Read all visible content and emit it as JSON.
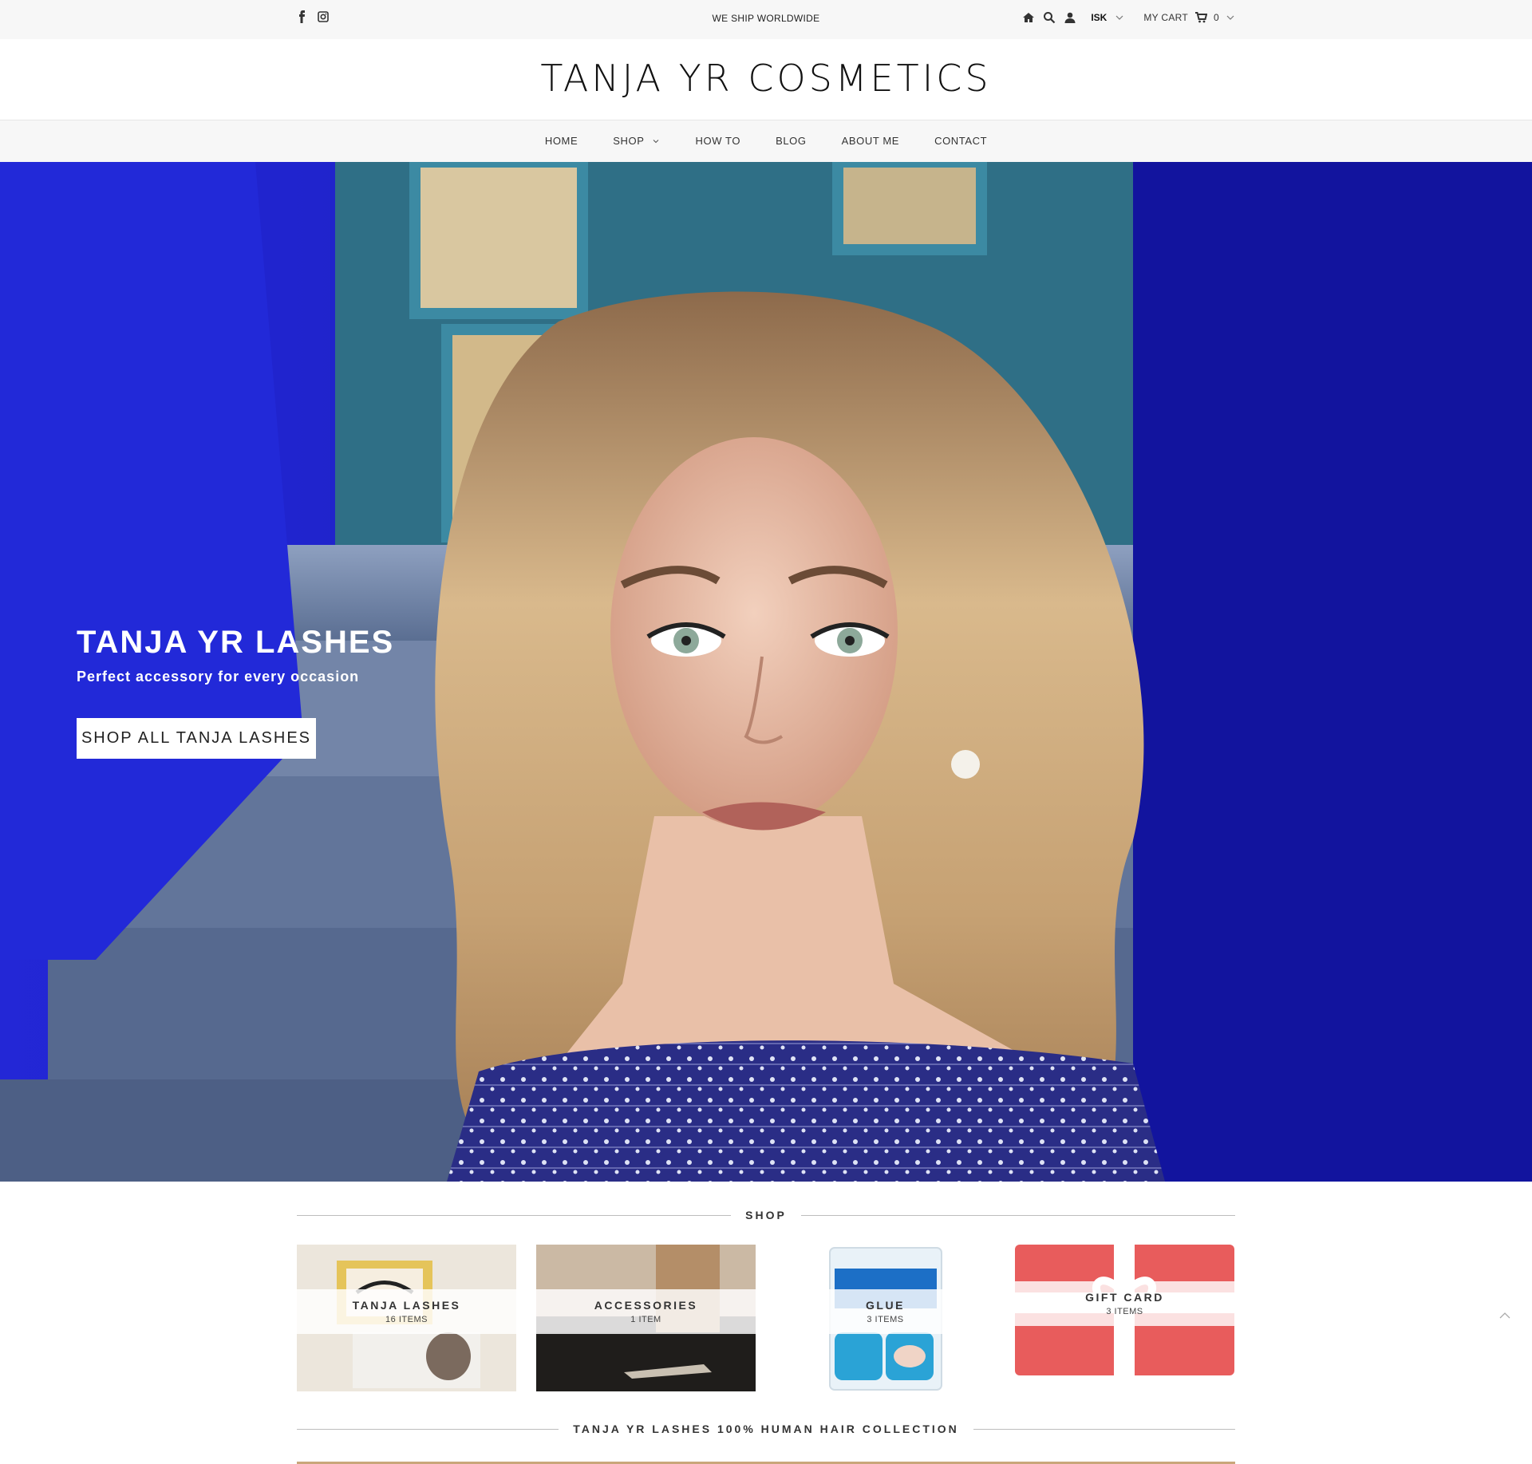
{
  "topbar": {
    "social": [
      "facebook-icon",
      "instagram-icon"
    ],
    "shipping_text": "WE SHIP WORLDWIDE",
    "currency": "ISK",
    "cart_label": "MY CART",
    "cart_count": "0"
  },
  "brand": {
    "logo": "TANJA YR COSMETICS"
  },
  "nav": {
    "items": [
      {
        "label": "HOME"
      },
      {
        "label": "SHOP"
      },
      {
        "label": "HOW TO"
      },
      {
        "label": "BLOG"
      },
      {
        "label": "ABOUT ME"
      },
      {
        "label": "CONTACT"
      }
    ]
  },
  "hero": {
    "title": "TANJA YR LASHES",
    "subtitle": "Perfect accessory for every occasion",
    "button_label": "SHOP ALL TANJA LASHES"
  },
  "shop": {
    "heading": "SHOP",
    "collections": [
      {
        "name": "TANJA LASHES",
        "count": "16 ITEMS"
      },
      {
        "name": "ACCESSORIES",
        "count": "1 ITEM"
      },
      {
        "name": "GLUE",
        "count": "3 ITEMS"
      },
      {
        "name": "GIFT CARD",
        "count": "3 ITEMS"
      }
    ]
  },
  "collection_heading": "TANJA YR LASHES 100% HUMAN HAIR COLLECTION",
  "colors": {
    "hero_blue": "#1a1ec8",
    "gift_red": "#e85c5c",
    "nav_bg": "#f7f7f7"
  }
}
